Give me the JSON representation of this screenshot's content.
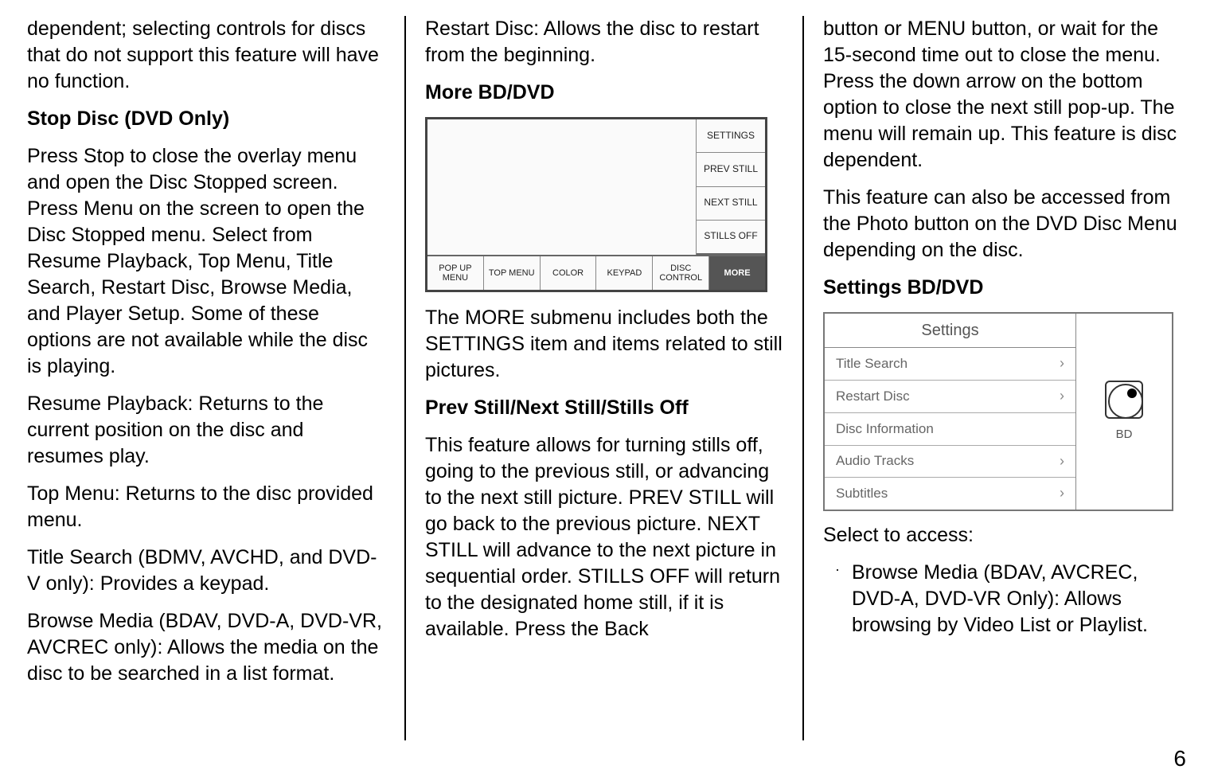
{
  "page_number": "6",
  "col1": {
    "p1": "dependent; selecting controls for discs that do not support this feature will have no function.",
    "h1": "Stop Disc (DVD Only)",
    "p2": "Press Stop to close the overlay menu and open the Disc Stopped screen. Press Menu on the screen to open the Disc Stopped menu. Select from Resume Playback, Top Menu, Title Search, Restart Disc, Browse Media, and Player Setup. Some of these options are not available while the disc is playing.",
    "p3": "Resume Playback: Returns to the current position on the disc and resumes play.",
    "p4": "Top Menu: Returns to the disc provided menu.",
    "p5": "Title Search (BDMV, AVCHD, and DVD-V only): Provides a keypad.",
    "p6": "Browse Media (BDAV, DVD-A, DVD-VR, AVCREC only): Allows the media on the disc to be searched in a list format."
  },
  "col2": {
    "p1": "Restart Disc: Allows the disc to restart from the beginning.",
    "h1": "More BD/DVD",
    "diagram1": {
      "side": [
        "SETTINGS",
        "PREV STILL",
        "NEXT STILL",
        "STILLS OFF"
      ],
      "bottom": [
        "POP UP MENU",
        "TOP MENU",
        "COLOR",
        "KEYPAD",
        "DISC CONTROL",
        "MORE"
      ]
    },
    "p2": "The MORE submenu includes both the SETTINGS item and items related to still pictures.",
    "h2": "Prev Still/Next Still/Stills Off",
    "p3": "This feature allows for turning stills off, going to the previous still, or advancing to the next still picture. PREV STILL will go back to the previous picture. NEXT STILL will advance to the next picture in sequential order. STILLS OFF will return to the designated home still, if it is available. Press the Back"
  },
  "col3": {
    "p1": "button or MENU button, or wait for the 15-second time out to close the menu. Press the down arrow on the bottom option to close the next still pop-up. The menu will remain up. This feature is disc dependent.",
    "p2": "This feature can also be accessed from the Photo button on the DVD Disc Menu depending on the disc.",
    "h1": "Settings BD/DVD",
    "diagram2": {
      "title": "Settings",
      "rows": [
        "Title Search",
        "Restart Disc",
        "Disc Information",
        "Audio Tracks",
        "Subtitles"
      ],
      "right_label": "BD"
    },
    "p3": "Select to access:",
    "bullet1": "Browse Media (BDAV, AVCREC, DVD-A, DVD-VR Only): Allows browsing by Video List or Playlist."
  }
}
